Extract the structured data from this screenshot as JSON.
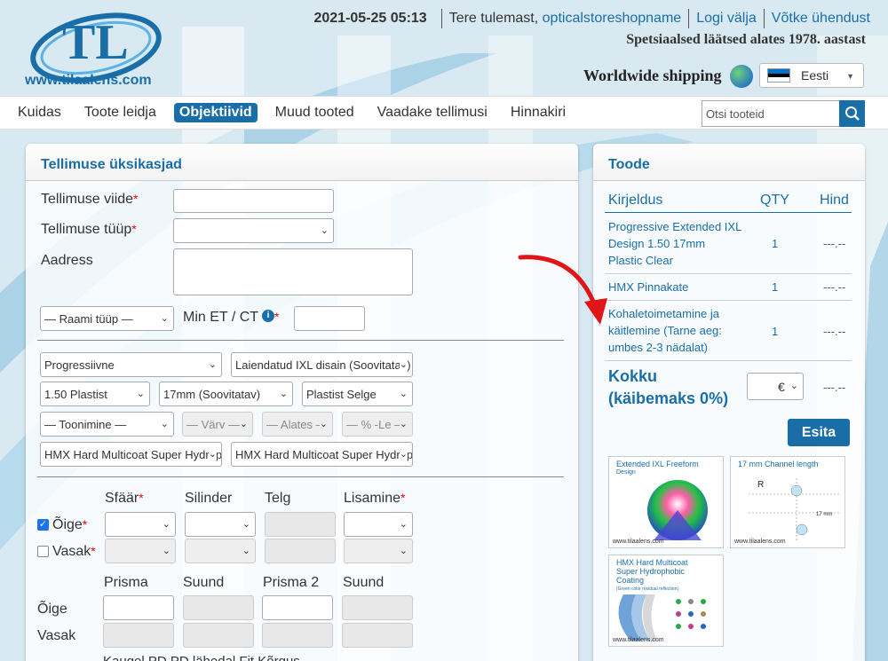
{
  "header": {
    "logo_url": "www.tilaalens.com",
    "datetime": "2021-05-25 05:13",
    "welcome_prefix": "Tere tulemast,",
    "username": "opticalstoreshopname",
    "logout": "Logi välja",
    "contact": "Võtke ühendust",
    "tagline": "Spetsiaalsed läätsed alates 1978. aastast",
    "shipping": "Worldwide shipping",
    "language": "Eesti"
  },
  "nav": {
    "items": [
      "Kuidas",
      "Toote leidja",
      "Objektiivid",
      "Muud tooted",
      "Vaadake tellimusi",
      "Hinnakiri"
    ],
    "active": "Objektiivid",
    "search_placeholder": "Otsi tooteid"
  },
  "order": {
    "title": "Tellimuse üksikasjad",
    "ref_label": "Tellimuse viide",
    "type_label": "Tellimuse tüüp",
    "address_label": "Aadress",
    "frame_type": "— Raami tüüp —",
    "min_et_ct": "Min ET / CT",
    "info": "i",
    "lens_design": "Progressiivne",
    "lens_variant": "Laiendatud IXL disain (Soovitatav)",
    "material": "1.50 Plastist",
    "channel": "17mm (Soovitatav)",
    "color": "Plastist Selge",
    "tint": "— Toonimine —",
    "tint_color": "— Värv —",
    "tint_from": "— Alates —",
    "tint_pct": "— % -Le —",
    "coating1": "HMX Hard Multicoat Super Hydrophobic",
    "coating2": "HMX Hard Multicoat Super Hydrophobic",
    "rx_headers": [
      "Sfäär",
      "Silinder",
      "Telg",
      "Lisamine"
    ],
    "right_eye": "Õige",
    "left_eye": "Vasak",
    "prism_headers": [
      "Prisma",
      "Suund",
      "Prisma 2",
      "Suund"
    ],
    "bottom_text": "Kaugel PD  PD lähedal  Fit Kõrgus"
  },
  "product": {
    "title": "Toode",
    "headers": {
      "desc": "Kirjeldus",
      "qty": "QTY",
      "price": "Hind"
    },
    "rows": [
      {
        "desc": "Progressive Extended IXL Design 1.50 17mm Plastic Clear",
        "qty": "1",
        "price": "---.--"
      },
      {
        "desc": "HMX Pinnakate",
        "qty": "1",
        "price": "---.--"
      },
      {
        "desc": "Kohaletoimetamine ja käitlemine (Tarne aeg: umbes 2-3 nädalat)",
        "qty": "1",
        "price": "---.--"
      }
    ],
    "total_label": "Kokku (käibemaks 0%)",
    "currency": "€",
    "total_price": "---.--",
    "submit": "Esita",
    "thumbs": [
      {
        "title": "Extended IXL Freeform",
        "sub": "Design"
      },
      {
        "title": "17 mm Channel length",
        "sub": ""
      },
      {
        "title": "HMX Hard Multicoat Super Hydrophobic Coating",
        "sub": "(Green color residual reflection)"
      }
    ],
    "watermark": "www.tilaalens.com"
  },
  "colors": {
    "accent": "#1a6ea8",
    "required": "#e00000"
  }
}
